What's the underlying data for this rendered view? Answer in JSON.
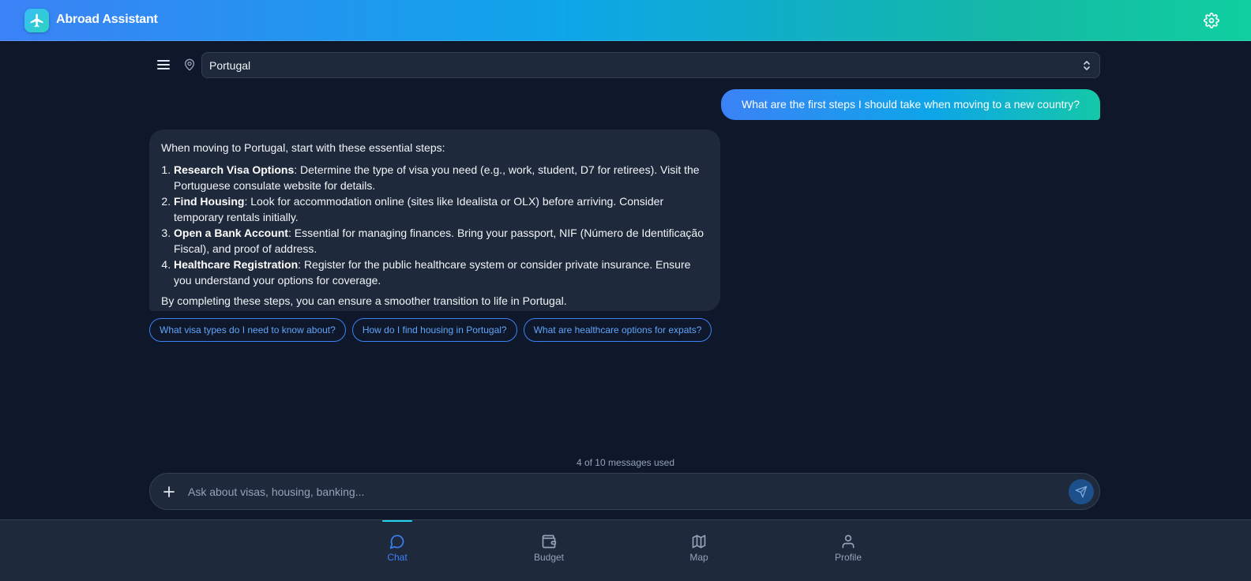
{
  "app": {
    "title": "Abroad Assistant",
    "logo_icon": "airplane-icon",
    "settings_icon": "gear-icon"
  },
  "country_bar": {
    "menu_icon": "hamburger-menu-icon",
    "location_icon": "map-pin-icon",
    "selected_country": "Portugal"
  },
  "conversation": {
    "user_message": "What are the first steps I should take when moving to a new country?",
    "assistant_message": {
      "intro": "When moving to Portugal, start with these essential steps:",
      "steps": [
        {
          "title": "Research Visa Options",
          "text": ": Determine the type of visa you need (e.g., work, student, D7 for retirees). Visit the Portuguese consulate website for details."
        },
        {
          "title": "Find Housing",
          "text": ": Look for accommodation online (sites like Idealista or OLX) before arriving. Consider temporary rentals initially."
        },
        {
          "title": "Open a Bank Account",
          "text": ": Essential for managing finances. Bring your passport, NIF (Número de Identificação Fiscal), and proof of address."
        },
        {
          "title": "Healthcare Registration",
          "text": ": Register for the public healthcare system or consider private insurance. Ensure you understand your options for coverage."
        }
      ],
      "outro": "By completing these steps, you can ensure a smoother transition to life in Portugal."
    },
    "suggestions": [
      "What visa types do I need to know about?",
      "How do I find housing in Portugal?",
      "What are healthcare options for expats?"
    ]
  },
  "usage": {
    "text": "4 of 10 messages used",
    "used": 4,
    "limit": 10
  },
  "composer": {
    "placeholder": "Ask about visas, housing, banking...",
    "value": "",
    "attach_icon": "plus-icon",
    "send_icon": "send-icon"
  },
  "bottom_nav": {
    "items": [
      {
        "label": "Chat",
        "icon": "chat-bubble-icon",
        "active": true
      },
      {
        "label": "Budget",
        "icon": "wallet-icon",
        "active": false
      },
      {
        "label": "Map",
        "icon": "map-icon",
        "active": false
      },
      {
        "label": "Profile",
        "icon": "user-icon",
        "active": false
      }
    ]
  },
  "colors": {
    "background": "#0f172a",
    "surface": "#1e293b",
    "accent_blue": "#3b82f6",
    "accent_teal": "#14b8a6",
    "muted_text": "#94a3b8"
  }
}
